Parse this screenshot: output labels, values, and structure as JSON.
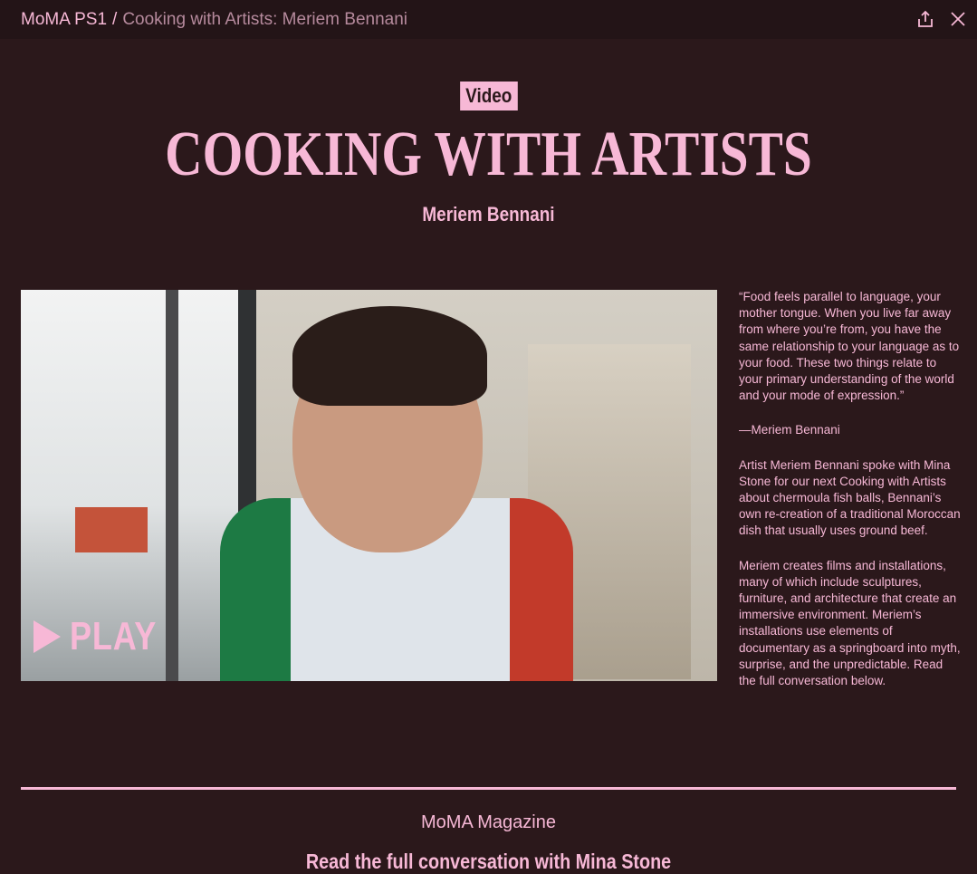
{
  "topbar": {
    "root": "MoMA PS1",
    "separator": "/",
    "current": "Cooking with Artists: Meriem Bennani",
    "share_icon": "share-icon",
    "close_icon": "close-icon"
  },
  "header": {
    "badge": "Video",
    "title": "COOKING WITH ARTISTS",
    "subtitle": "Meriem Bennani"
  },
  "video": {
    "play_label": "PLAY"
  },
  "side": {
    "quote": "“Food feels parallel to language, your mother tongue. When you live far away from where you’re from, you have the same relationship to your language as to your food. These two things relate to your primary understanding of the world and your mode of expression.”",
    "attribution": "—Meriem Bennani",
    "para1": "Artist Meriem Bennani spoke with Mina Stone for our next Cooking with Artists about chermoula fish balls, Bennani’s own re-creation of a traditional Moroccan dish that usually uses ground beef.",
    "para2": "Meriem creates films and installations, many of which include sculptures, furniture, and architecture that create an immersive environment. Meriem’s installations use elements of documentary as a springboard into myth, surprise, and the unpredictable. Read the full conversation below."
  },
  "footer": {
    "section": "MoMA Magazine",
    "link": "Read the full conversation with Mina Stone"
  },
  "colors": {
    "background": "#2b181b",
    "topbar": "#231417",
    "accent": "#f7b8d6",
    "muted": "#b68a9d"
  }
}
